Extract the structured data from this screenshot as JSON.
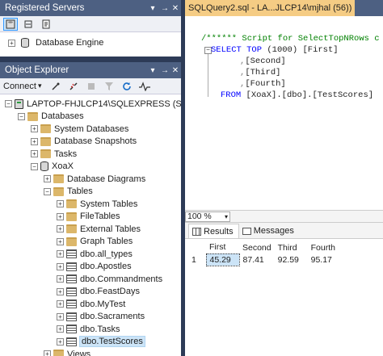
{
  "registered_servers": {
    "title": "Registered Servers",
    "pin": "▾",
    "autohide": " →",
    "close": "✕",
    "db_engine": "Database Engine"
  },
  "object_explorer": {
    "title": "Object Explorer",
    "pin": "▾",
    "autohide": " →",
    "close": "✕",
    "connect": "Connect",
    "connect_dd": "▾",
    "tree": [
      {
        "id": "server",
        "label": "LAPTOP-FHJLCP14\\SQLEXPRESS (SQL S",
        "level": 0,
        "expander": "−",
        "icon": "server"
      },
      {
        "id": "databases",
        "label": "Databases",
        "level": 1,
        "expander": "−",
        "icon": "folder"
      },
      {
        "id": "system-databases",
        "label": "System Databases",
        "level": 2,
        "expander": "+",
        "icon": "folder"
      },
      {
        "id": "database-snapshots",
        "label": "Database Snapshots",
        "level": 2,
        "expander": "+",
        "icon": "folder"
      },
      {
        "id": "tasks-folder",
        "label": "Tasks",
        "level": 2,
        "expander": "+",
        "icon": "folder"
      },
      {
        "id": "xoax",
        "label": "XoaX",
        "level": 2,
        "expander": "−",
        "icon": "db"
      },
      {
        "id": "database-diagrams",
        "label": "Database Diagrams",
        "level": 3,
        "expander": "+",
        "icon": "folder"
      },
      {
        "id": "tables",
        "label": "Tables",
        "level": 3,
        "expander": "−",
        "icon": "folder"
      },
      {
        "id": "system-tables",
        "label": "System Tables",
        "level": 4,
        "expander": "+",
        "icon": "folder"
      },
      {
        "id": "filetables",
        "label": "FileTables",
        "level": 4,
        "expander": "+",
        "icon": "folder"
      },
      {
        "id": "external-tables",
        "label": "External Tables",
        "level": 4,
        "expander": "+",
        "icon": "folder"
      },
      {
        "id": "graph-tables",
        "label": "Graph Tables",
        "level": 4,
        "expander": "+",
        "icon": "folder"
      },
      {
        "id": "dbo-all-types",
        "label": "dbo.all_types",
        "level": 4,
        "expander": "+",
        "icon": "table"
      },
      {
        "id": "dbo-apostles",
        "label": "dbo.Apostles",
        "level": 4,
        "expander": "+",
        "icon": "table"
      },
      {
        "id": "dbo-commandments",
        "label": "dbo.Commandments",
        "level": 4,
        "expander": "+",
        "icon": "table"
      },
      {
        "id": "dbo-feastdays",
        "label": "dbo.FeastDays",
        "level": 4,
        "expander": "+",
        "icon": "table"
      },
      {
        "id": "dbo-mytest",
        "label": "dbo.MyTest",
        "level": 4,
        "expander": "+",
        "icon": "table"
      },
      {
        "id": "dbo-sacraments",
        "label": "dbo.Sacraments",
        "level": 4,
        "expander": "+",
        "icon": "table"
      },
      {
        "id": "dbo-tasks",
        "label": "dbo.Tasks",
        "level": 4,
        "expander": "+",
        "icon": "table"
      },
      {
        "id": "dbo-testscores",
        "label": "dbo.TestScores",
        "level": 4,
        "expander": "+",
        "icon": "table",
        "selected": true
      },
      {
        "id": "views",
        "label": "Views",
        "level": 3,
        "expander": "+",
        "icon": "folder"
      }
    ]
  },
  "editor": {
    "tab_title": "SQLQuery2.sql - LA...JLCP14\\mjhal (56))",
    "code": {
      "comment": "/****** Script for SelectTopNRows c",
      "select_kw": "SELECT",
      "top_kw": "TOP",
      "top_n": "(1000)",
      "col1": "[First]",
      "col2": "[Second]",
      "col3": "[Third]",
      "col4": "[Fourth]",
      "from_kw": "FROM",
      "source": "[XoaX].[dbo].[TestScores]",
      "comma": ","
    },
    "zoom": "100 %",
    "zoom_dd": "▾"
  },
  "results": {
    "tabs": [
      "Results",
      "Messages"
    ],
    "columns": [
      "",
      "First",
      "Second",
      "Third",
      "Fourth"
    ],
    "rows": [
      [
        "1",
        "45.29",
        "87.41",
        "92.59",
        "95.17"
      ]
    ]
  }
}
